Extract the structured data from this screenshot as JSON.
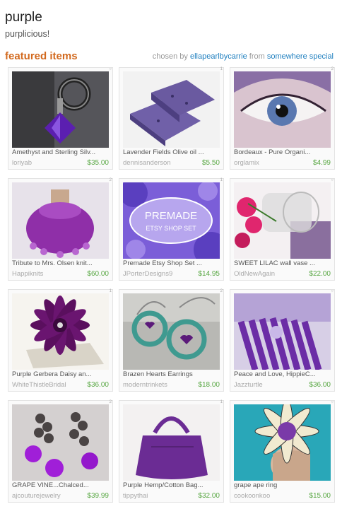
{
  "header": {
    "title": "purple",
    "subtitle": "purplicious!",
    "featured_label": "featured items",
    "chosen_by_label": "chosen by",
    "curator": "ellapearlbycarrie",
    "from_label": "from",
    "location": "somewhere special"
  },
  "colors": {
    "accent": "#d2691e",
    "link": "#1f7fbf",
    "price": "#5aa845"
  },
  "items": [
    {
      "name": "Amethyst and Sterling Silv...",
      "shop": "loriyab",
      "price": "$35.00",
      "tag": "○"
    },
    {
      "name": "Lavender Fields Olive oil ...",
      "shop": "dennisanderson",
      "price": "$5.50",
      "tag": "1"
    },
    {
      "name": "Bordeaux - Pure Organi...",
      "shop": "orglamix",
      "price": "$4.99",
      "tag": "2"
    },
    {
      "name": "Tribute to Mrs. Olsen knit...",
      "shop": "Happiknits",
      "price": "$60.00",
      "tag": "2"
    },
    {
      "name": "Premade Etsy Shop Set ...",
      "shop": "JPorterDesigns9",
      "price": "$14.95",
      "tag": "1"
    },
    {
      "name": "SWEET LILAC wall vase ...",
      "shop": "OldNewAgain",
      "price": "$22.00",
      "tag": "○"
    },
    {
      "name": "Purple Gerbera Daisy an...",
      "shop": "WhiteThistleBridal",
      "price": "$36.00",
      "tag": "1"
    },
    {
      "name": "Brazen Hearts Earrings",
      "shop": "moderntrinkets",
      "price": "$18.00",
      "tag": "2"
    },
    {
      "name": "Peace and Love, HippieC...",
      "shop": "Jazzturtle",
      "price": "$36.00",
      "tag": "○"
    },
    {
      "name": "GRAPE VINE...Chalced...",
      "shop": "ajcouturejewelry",
      "price": "$39.99",
      "tag": "2"
    },
    {
      "name": "Purple Hemp/Cotton Bag...",
      "shop": "tippythai",
      "price": "$32.00",
      "tag": "1"
    },
    {
      "name": "grape ape ring",
      "shop": "cookoonkoo",
      "price": "$15.00",
      "tag": "○"
    }
  ],
  "banner": {
    "line1": "PREMADE",
    "line2": "ETSY SHOP SET"
  }
}
